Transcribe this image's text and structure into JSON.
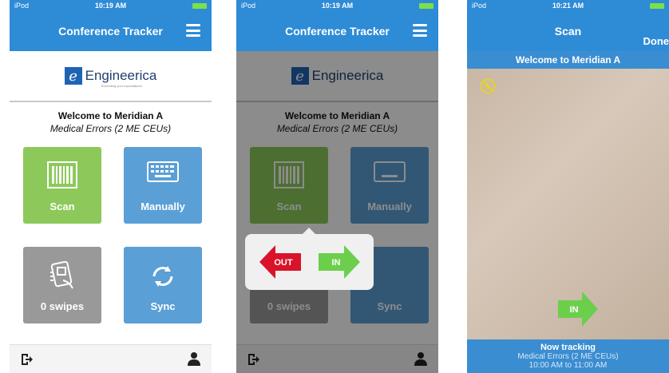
{
  "colors": {
    "nav_blue": "#2e8bd6",
    "scan_green": "#8cc95a",
    "tile_blue": "#5a9fd6",
    "tile_gray": "#999999",
    "out_red": "#d9142a",
    "in_green": "#6ccf4c"
  },
  "screen1": {
    "status": {
      "carrier": "iPod",
      "time": "10:19 AM"
    },
    "nav_title": "Conference Tracker",
    "logo": {
      "mark": "e",
      "text": "Engineerica",
      "tagline": "Exceeding your expectations"
    },
    "welcome": "Welcome to Meridian A",
    "session": "Medical Errors (2 ME CEUs)",
    "tiles": {
      "scan": "Scan",
      "manual": "Manually",
      "swipes": "0 swipes",
      "sync": "Sync"
    }
  },
  "screen2": {
    "status": {
      "carrier": "iPod",
      "time": "10:19 AM"
    },
    "nav_title": "Conference Tracker",
    "logo": {
      "mark": "e",
      "text": "Engineerica"
    },
    "welcome": "Welcome to Meridian A",
    "session": "Medical Errors (2 ME CEUs)",
    "tiles": {
      "scan": "Scan",
      "manual": "Manually",
      "swipes": "0 swipes",
      "sync": "Sync"
    },
    "popup": {
      "out": "OUT",
      "in": "IN"
    }
  },
  "screen3": {
    "status": {
      "carrier": "iPod",
      "time": "10:21 AM"
    },
    "nav_title": "Scan",
    "done": "Done",
    "banner": "Welcome to Meridian A",
    "arrow": "IN",
    "tracking": {
      "title": "Now tracking",
      "session": "Medical Errors (2 ME CEUs)",
      "time": "10:00 AM to 11:00 AM"
    }
  }
}
